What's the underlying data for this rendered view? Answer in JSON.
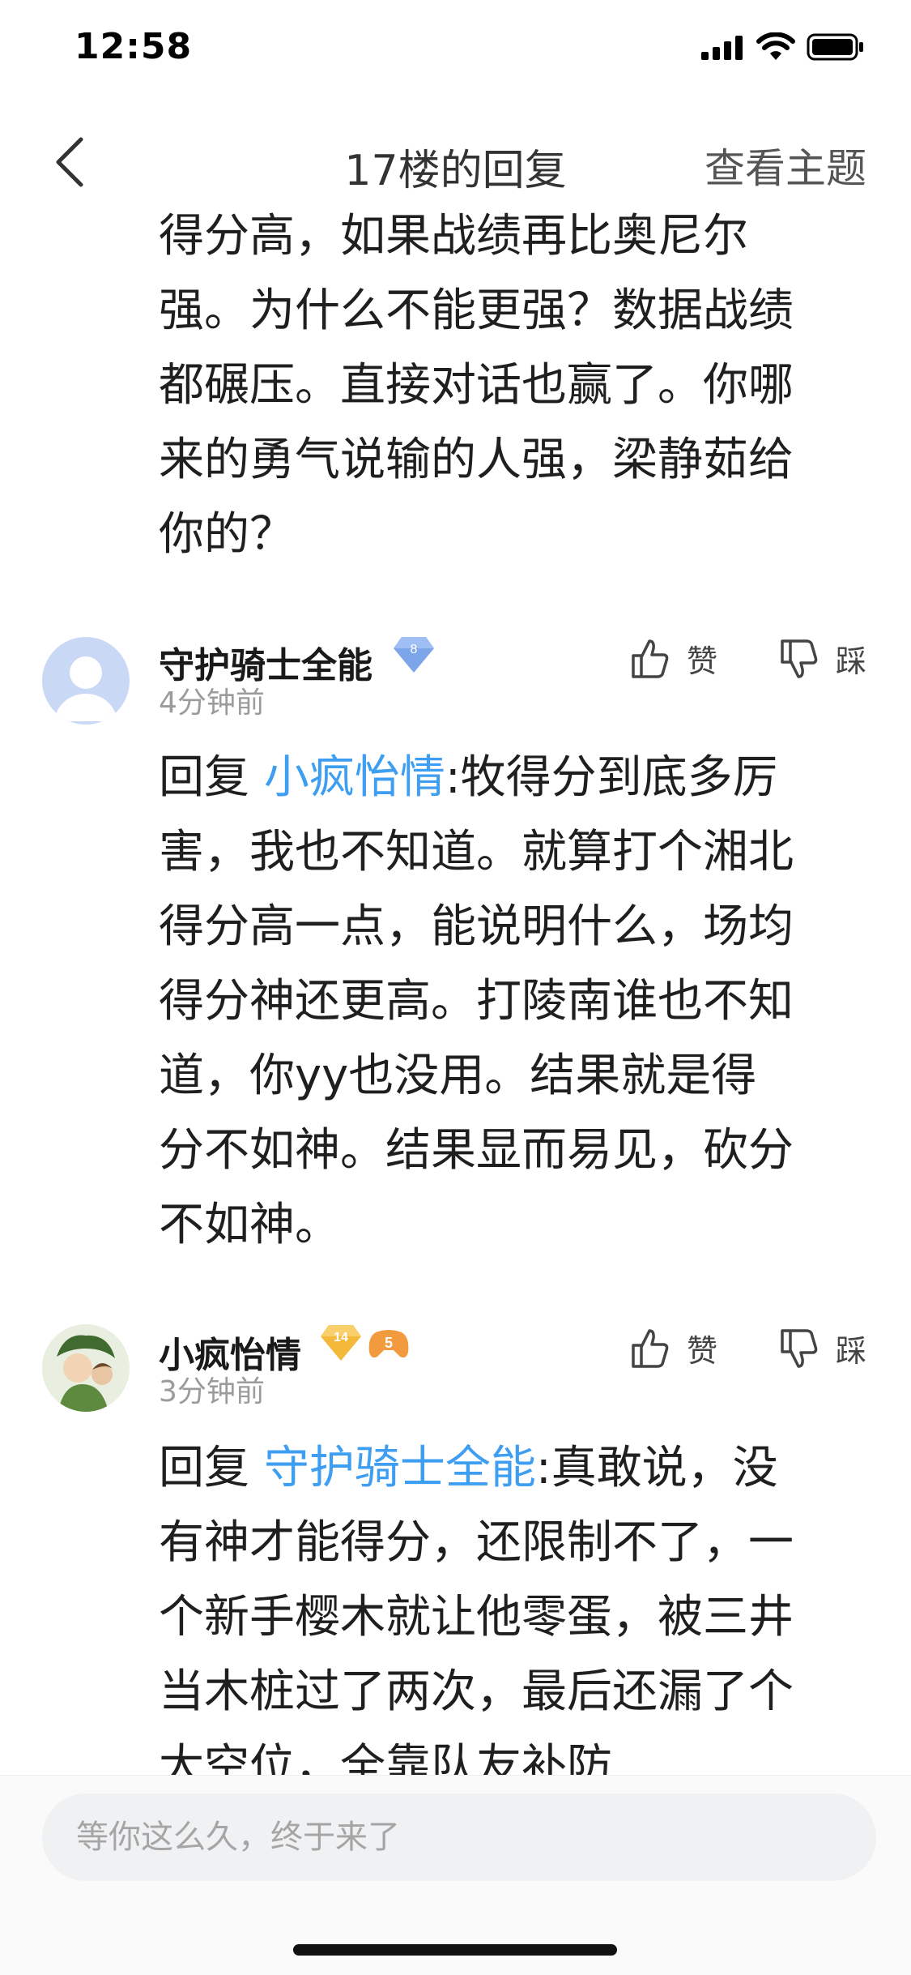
{
  "status_bar": {
    "time": "12:58"
  },
  "nav": {
    "title": "17楼的回复",
    "right_link": "查看主题"
  },
  "top_post": {
    "lines": [
      "得分高，如果战绩再比奥尼尔",
      "强。为什么不能更强？数据战绩",
      "都碾压。直接对话也赢了。你哪",
      "来的勇气说输的人强，梁静茹给",
      "你的？"
    ]
  },
  "comments": [
    {
      "username": "守护骑士全能",
      "level": "8",
      "time": "4分钟前",
      "like_label": "赞",
      "dislike_label": "踩",
      "reply_prefix": "回复 ",
      "mention": "小疯怡情",
      "first_line_rest": ":牧得分到底多厉",
      "lines": [
        "害，我也不知道。就算打个湘北",
        "得分高一点，能说明什么，场均",
        "得分神还更高。打陵南谁也不知",
        "道，你yy也没用。结果就是得",
        "分不如神。结果显而易见，砍分",
        "不如神。"
      ]
    },
    {
      "username": "小疯怡情",
      "level": "14",
      "badge": "5",
      "time": "3分钟前",
      "like_label": "赞",
      "dislike_label": "踩",
      "reply_prefix": "回复 ",
      "mention": "守护骑士全能",
      "first_line_rest": ":真敢说，没",
      "lines": [
        "有神才能得分，还限制不了，一",
        "个新手樱木就让他零蛋，被三井",
        "当木桩过了两次，最后还漏了个",
        "大空位，全靠队友补防"
      ]
    }
  ],
  "reply_bar": {
    "placeholder": "等你这么久，终于来了"
  }
}
